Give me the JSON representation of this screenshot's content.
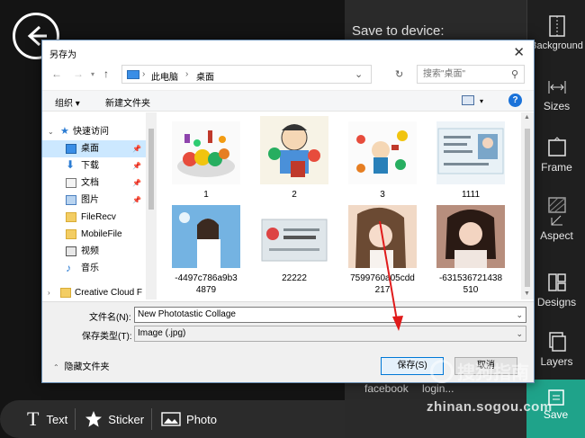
{
  "app": {
    "save_to_device": "Save to device:",
    "right_bar": {
      "background": "Background",
      "sizes": "Sizes",
      "frame": "Frame",
      "aspect": "Aspect",
      "designs": "Designs",
      "layers": "Layers",
      "save": "Save"
    },
    "share": {
      "facebook": "facebook",
      "login": "login..."
    },
    "bottom_bar": {
      "text": "Text",
      "sticker": "Sticker",
      "photo": "Photo"
    },
    "accent_color": "#1fa38a"
  },
  "dialog": {
    "title": "另存为",
    "address": {
      "crumb1": "此电脑",
      "crumb2": "桌面"
    },
    "search_placeholder": "搜索\"桌面\"",
    "toolbar": {
      "organize": "组织 ▾",
      "new_folder": "新建文件夹"
    },
    "nav": [
      {
        "label": "快速访问",
        "icon": "star-icon"
      },
      {
        "label": "桌面",
        "icon": "desktop-icon"
      },
      {
        "label": "下载",
        "icon": "download-icon"
      },
      {
        "label": "文档",
        "icon": "document-icon"
      },
      {
        "label": "图片",
        "icon": "picture-icon"
      },
      {
        "label": "FileRecv",
        "icon": "folder-icon"
      },
      {
        "label": "MobileFile",
        "icon": "folder-icon"
      },
      {
        "label": "视频",
        "icon": "video-icon"
      },
      {
        "label": "音乐",
        "icon": "music-icon"
      },
      {
        "label": "Creative Cloud F",
        "icon": "folder-icon"
      }
    ],
    "files": [
      {
        "name": "1"
      },
      {
        "name": "2"
      },
      {
        "name": "3"
      },
      {
        "name": "1111"
      },
      {
        "name": "-4497c786a9b3\n4879"
      },
      {
        "name": "22222"
      },
      {
        "name": "7599760a05cdd\n217"
      },
      {
        "name": "-631536721438\n510"
      }
    ],
    "form": {
      "filename_label": "文件名(N):",
      "filename_value": "New Phototastic Collage",
      "filetype_label": "保存类型(T):",
      "filetype_value": "Image (.jpg)"
    },
    "footer": {
      "hide_folders": "隐藏文件夹",
      "save": "保存(S)",
      "cancel": "取消"
    }
  },
  "watermark": {
    "logo": "搜狗指南",
    "url": "zhinan.sogou.com"
  }
}
